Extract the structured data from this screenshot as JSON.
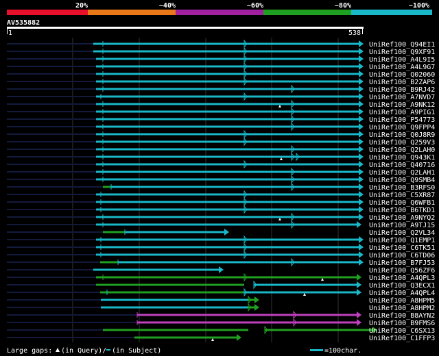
{
  "legend": {
    "labels": [
      "20%",
      "~40%",
      "~60%",
      "~80%",
      "~100%"
    ],
    "colors": [
      "#e8102a",
      "#e87818",
      "#a020a0",
      "#20a020",
      "#18b8c8"
    ]
  },
  "query": {
    "name": "AV535882",
    "start": "1",
    "end": "538"
  },
  "colors": {
    "cyan": "#18b8c8",
    "green": "#20a020",
    "magenta": "#c040c0",
    "dark": "#141a3c",
    "grid": "#333333",
    "white": "#ffffff"
  },
  "hits": [
    {
      "name": "UniRef100_Q94EI1"
    },
    {
      "name": "UniRef100_Q9XF91"
    },
    {
      "name": "UniRef100_A4L9I5"
    },
    {
      "name": "UniRef100_A4L9G7"
    },
    {
      "name": "UniRef100_Q02060"
    },
    {
      "name": "UniRef100_B2ZAP6"
    },
    {
      "name": "UniRef100_B9RJ42"
    },
    {
      "name": "UniRef100_A7NVD7"
    },
    {
      "name": "UniRef100_A9NK12"
    },
    {
      "name": "UniRef100_A9PIG1"
    },
    {
      "name": "UniRef100_P54773"
    },
    {
      "name": "UniRef100_Q9FPP4"
    },
    {
      "name": "UniRef100_Q0J8R9"
    },
    {
      "name": "UniRef100_Q259V3"
    },
    {
      "name": "UniRef100_Q2LAH0"
    },
    {
      "name": "UniRef100_Q943K1"
    },
    {
      "name": "UniRef100_Q40716"
    },
    {
      "name": "UniRef100_Q2LAH1"
    },
    {
      "name": "UniRef100_Q9SMB4"
    },
    {
      "name": "UniRef100_B3RFS0"
    },
    {
      "name": "UniRef100_C5XR87"
    },
    {
      "name": "UniRef100_Q6WFB1"
    },
    {
      "name": "UniRef100_B6TKD1"
    },
    {
      "name": "UniRef100_A9NYQ2"
    },
    {
      "name": "UniRef100_A9TJ15"
    },
    {
      "name": "UniRef100_Q2VL34"
    },
    {
      "name": "UniRef100_Q1EMP1"
    },
    {
      "name": "UniRef100_C6TK51"
    },
    {
      "name": "UniRef100_C6TD06"
    },
    {
      "name": "UniRef100_B7FJ53"
    },
    {
      "name": "UniRef100_Q56ZF6"
    },
    {
      "name": "UniRef100_A4QPL3"
    },
    {
      "name": "UniRef100_Q3ECX1"
    },
    {
      "name": "UniRef100_A4QPL4"
    },
    {
      "name": "UniRef100_A8HPM5"
    },
    {
      "name": "UniRef100_A8HPM2"
    },
    {
      "name": "UniRef100_B8AYN2"
    },
    {
      "name": "UniRef100_B9FMS6"
    },
    {
      "name": "UniRef100_C6SX13"
    },
    {
      "name": "UniRef100_C1FFP3"
    }
  ],
  "footer": {
    "gaps_label": "Large gaps:",
    "in_query": "(in Query)/",
    "in_subject": "(in Subject)",
    "scale": "=100char."
  }
}
